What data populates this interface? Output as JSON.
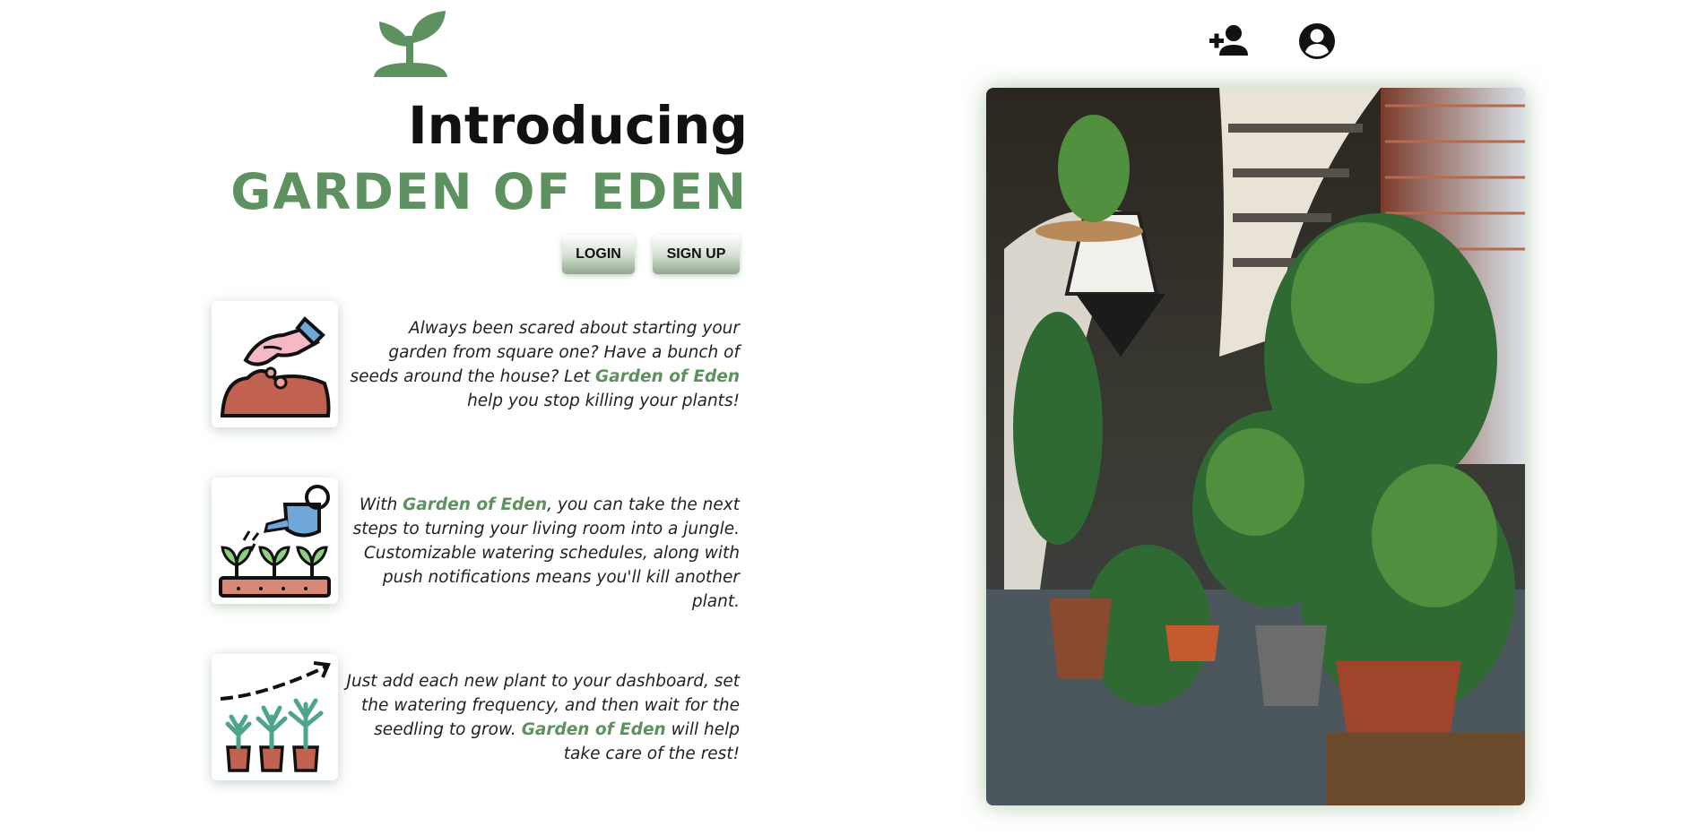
{
  "header": {
    "logo_icon": "sprout-icon",
    "add_user_icon": "person-add-icon",
    "account_icon": "account-circle-icon"
  },
  "hero": {
    "intro": "Introducing",
    "brand": "GARDEN OF EDEN"
  },
  "auth": {
    "login_label": "LOGIN",
    "signup_label": "SIGN UP"
  },
  "features": [
    {
      "icon": "hand-sowing-seeds-icon",
      "text_before": "Always been scared about starting your garden from square one? Have a bunch of seeds around the house? Let ",
      "highlight": "Garden of Eden",
      "text_after": " help you stop killing your plants!"
    },
    {
      "icon": "watering-can-seedlings-icon",
      "text_before": "With ",
      "highlight": "Garden of Eden",
      "text_after": ", you can take the next steps to turning your living room into a jungle. Customizable watering schedules, along with push notifications means you'll kill another plant."
    },
    {
      "icon": "growing-plants-chart-icon",
      "text_before": "Just add each new plant to your dashboard, set the watering frequency, and then wait for the seedling to grow. ",
      "highlight": "Garden of Eden",
      "text_after": " will help take care of the rest!"
    }
  ],
  "photo": {
    "subject": "indoor-plants-spiral-staircase-photo"
  },
  "colors": {
    "brand_green": "#5e9160",
    "text_dark": "#111111",
    "button_gradient_bottom": "#8fa88d"
  }
}
